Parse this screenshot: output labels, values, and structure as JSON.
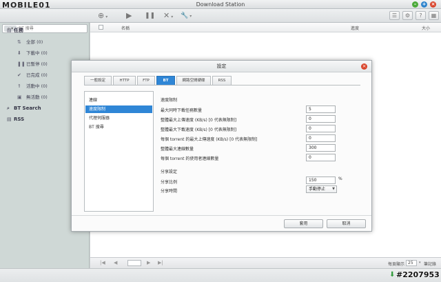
{
  "window": {
    "logo": "MOBILE01",
    "title": "Download Station",
    "min": "–",
    "max": "+",
    "close": "×"
  },
  "toolbar": {
    "add": "⊕",
    "start": "▶",
    "pause": "❚❚",
    "delete": "✕",
    "tools": "🔧",
    "caret": "▾",
    "list": "☰",
    "settings": "⚙",
    "help": "?",
    "options": "▦"
  },
  "sidebar": {
    "search_icon_label": "⌕ ▾",
    "search_placeholder": "BT 搜尋",
    "task_header": "任務",
    "task_icon": "▤",
    "items": [
      {
        "icon": "⇅",
        "label": "全部 (0)"
      },
      {
        "icon": "⬇",
        "label": "下載中 (0)"
      },
      {
        "icon": "❚❚",
        "label": "已暫停 (0)"
      },
      {
        "icon": "✔",
        "label": "已完成 (0)"
      },
      {
        "icon": "⇑",
        "label": "活動中 (0)"
      },
      {
        "icon": "▣",
        "label": "無活動 (0)"
      }
    ],
    "bt_search": "BT Search",
    "bt_search_icon": "⌕",
    "rss": "RSS",
    "rss_icon": "▤"
  },
  "list": {
    "columns": [
      "名稱",
      "進度",
      "大小"
    ]
  },
  "pager": {
    "first": "|◀",
    "prev": "◀",
    "next": "▶",
    "last": "▶|",
    "per_page_label": "每頁顯示",
    "per_page_value": "25",
    "display_label": "筆記錄"
  },
  "status": {
    "arrow": "⬇",
    "watermark": "#2207953"
  },
  "dialog": {
    "title": "設定",
    "close": "×",
    "tabs": [
      "一般設定",
      "HTTP",
      "FTP",
      "BT",
      "網路空間硬碟",
      "RSS"
    ],
    "active_tab": "BT",
    "categories": [
      "連線",
      "速度限制",
      "代理伺服器",
      "BT 搜尋"
    ],
    "active_category": "速度限制",
    "speed_section": "速度限制",
    "rows": [
      {
        "label": "最大同時下載任務數量",
        "value": "5"
      },
      {
        "label": "整體最大上傳速度 (KB/s) [0 代表無限制]",
        "value": "0"
      },
      {
        "label": "整體最大下載速度 (KB/s) [0 代表無限制]",
        "value": "0"
      },
      {
        "label": "每個 torrent 的最大上傳速度 (KB/s) [0 代表無限制]",
        "value": "0"
      },
      {
        "label": "整體最大連線數量",
        "value": "300"
      },
      {
        "label": "每個 torrent 的使用者連線數量",
        "value": "0"
      }
    ],
    "share_section": "分享設定",
    "share_ratio_label": "分享比例",
    "share_ratio_value": "150",
    "share_ratio_unit": "%",
    "share_time_label": "分享時間",
    "share_time_value": "手動停止",
    "apply": "套用",
    "cancel": "取消"
  }
}
